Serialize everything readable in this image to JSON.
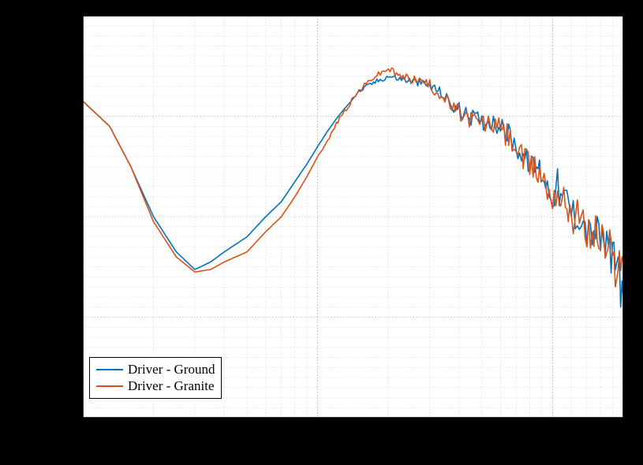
{
  "chart_data": {
    "type": "line",
    "xscale": "log",
    "xlim": [
      1,
      200
    ],
    "ylim": [
      -160,
      -80
    ],
    "grid": true,
    "minor_grid": true,
    "legend_position": "bottom-left",
    "series": [
      {
        "name": "Driver - Ground",
        "color": "#0072BD",
        "x": [
          1,
          1.3,
          1.6,
          2,
          2.5,
          3,
          3.5,
          4,
          5,
          6,
          7,
          8,
          9,
          10,
          11,
          12,
          13,
          15,
          17,
          20,
          22,
          25,
          28,
          30,
          33,
          36,
          38,
          40,
          42,
          45,
          48,
          50,
          55,
          58,
          60,
          63,
          66,
          70,
          75,
          80,
          84,
          88,
          92,
          95,
          100,
          105,
          110,
          115,
          120,
          125,
          130,
          135,
          140,
          145,
          150,
          155,
          160,
          165,
          170,
          175,
          180,
          185,
          190,
          195,
          200
        ],
        "y": [
          -97,
          -102,
          -110,
          -120,
          -127,
          -130.5,
          -129,
          -127,
          -124,
          -120,
          -117,
          -113,
          -109.5,
          -106,
          -103,
          -100.5,
          -98.5,
          -95,
          -93.5,
          -92,
          -92.5,
          -93,
          -93.5,
          -94,
          -95,
          -97,
          -98,
          -99,
          -99.5,
          -100,
          -100.5,
          -101,
          -101,
          -101.5,
          -102,
          -103,
          -104,
          -106,
          -108,
          -109.5,
          -110,
          -110.5,
          -112,
          -114,
          -116,
          -114,
          -117,
          -116,
          -119,
          -120,
          -119,
          -121,
          -122,
          -124,
          -122,
          -123,
          -125,
          -124,
          -127,
          -126,
          -129,
          -131,
          -128,
          -133,
          -136
        ],
        "jitter": [
          0,
          0,
          0,
          0,
          0,
          0,
          0,
          0,
          0,
          0,
          0,
          0,
          0,
          0,
          0,
          0,
          0,
          0.4,
          0.5,
          0.6,
          0.6,
          0.8,
          0.8,
          1.2,
          0.9,
          1.4,
          1.6,
          2.1,
          1.3,
          1.8,
          1.5,
          1.9,
          1.7,
          2.2,
          1.4,
          2.4,
          2.6,
          2.1,
          2.8,
          1.9,
          2.3,
          3.1,
          2.7,
          3.4,
          2.5,
          3.8,
          2.9,
          3.2,
          4.1,
          3.5,
          3.9,
          3.3,
          4.4,
          3.7,
          4.8,
          3.6,
          4.2,
          5.1,
          4.5,
          3.8,
          5.4,
          4.7,
          4.3,
          5.7,
          4.9
        ]
      },
      {
        "name": "Driver - Granite",
        "color": "#D95319",
        "x": [
          1,
          1.3,
          1.6,
          2,
          2.5,
          3,
          3.5,
          4,
          5,
          6,
          7,
          8,
          9,
          10,
          11,
          12,
          13,
          15,
          17,
          20,
          22,
          25,
          28,
          30,
          33,
          36,
          38,
          40,
          42,
          45,
          48,
          50,
          55,
          58,
          60,
          63,
          66,
          70,
          75,
          80,
          84,
          88,
          92,
          95,
          100,
          105,
          110,
          115,
          120,
          125,
          130,
          135,
          140,
          145,
          150,
          155,
          160,
          165,
          170,
          175,
          180,
          185,
          190,
          195,
          200
        ],
        "y": [
          -97,
          -102,
          -110,
          -121,
          -128,
          -131,
          -130.5,
          -129,
          -127,
          -123,
          -120,
          -116,
          -112,
          -108,
          -105,
          -101.5,
          -99,
          -95,
          -92.5,
          -90.5,
          -92,
          -92.5,
          -93,
          -94,
          -95.5,
          -97.5,
          -98.5,
          -99.5,
          -100,
          -100.5,
          -101,
          -101.5,
          -101.5,
          -102,
          -102.5,
          -103.5,
          -104.5,
          -106.5,
          -108.5,
          -110,
          -110.5,
          -111,
          -112.5,
          -114.5,
          -116,
          -114.5,
          -117.5,
          -116.5,
          -119.5,
          -120.5,
          -119.5,
          -121.5,
          -122.5,
          -124.5,
          -122.5,
          -123.5,
          -125.5,
          -124.5,
          -127.5,
          -126.5,
          -129,
          -130,
          -127.5,
          -131,
          -129
        ],
        "jitter": [
          0,
          0,
          0,
          0,
          0,
          0,
          0,
          0,
          0,
          0,
          0,
          0,
          0,
          0,
          0.3,
          0.4,
          0.5,
          0.6,
          0.5,
          0.7,
          0.8,
          0.9,
          0.7,
          1.3,
          1.1,
          1.5,
          1.7,
          2.0,
          1.4,
          1.9,
          1.6,
          2.2,
          1.8,
          2.5,
          1.5,
          2.7,
          2.3,
          2.0,
          3.1,
          2.4,
          2.8,
          3.5,
          2.6,
          3.3,
          2.9,
          3.7,
          3.2,
          4.0,
          3.8,
          3.4,
          4.3,
          3.6,
          4.6,
          4.1,
          4.9,
          3.9,
          4.4,
          5.3,
          4.2,
          4.7,
          5.0,
          4.5,
          5.6,
          4.8,
          5.2
        ]
      }
    ]
  },
  "legend": {
    "items": [
      "Driver - Ground",
      "Driver - Granite"
    ],
    "colors": [
      "#0072BD",
      "#D95319"
    ]
  }
}
